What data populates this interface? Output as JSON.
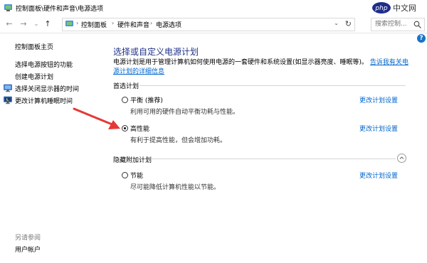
{
  "window": {
    "title": "控制面板\\硬件和声音\\电源选项",
    "watermark": "php中文网"
  },
  "nav": {
    "breadcrumb": [
      "控制面板",
      "硬件和声音",
      "电源选项"
    ],
    "search_placeholder": "搜索控制..."
  },
  "sidebar": {
    "home": "控制面板主页",
    "items": [
      {
        "label": "选择电源按钮的功能",
        "icon": ""
      },
      {
        "label": "创建电源计划",
        "icon": ""
      },
      {
        "label": "选择关闭显示器的时间",
        "icon": "monitor-icon"
      },
      {
        "label": "更改计算机睡眠时间",
        "icon": "moon-icon"
      }
    ],
    "see_also": "另请参阅",
    "user_accounts": "用户帐户"
  },
  "main": {
    "title": "选择或自定义电源计划",
    "description": "电源计划是用于管理计算机如何使用电源的一套硬件和系统设置(如显示器亮度、睡眠等)。",
    "description_link": "告诉我有关电源计划的详细信息",
    "preferred_label": "首选计划",
    "hidden_label": "隐藏附加计划",
    "plans": [
      {
        "name": "平衡 (推荐)",
        "desc": "利用可用的硬件自动平衡功耗与性能。",
        "link": "更改计划设置",
        "selected": false
      },
      {
        "name": "高性能",
        "desc": "有利于提高性能，但会增加功耗。",
        "link": "更改计划设置",
        "selected": true
      },
      {
        "name": "节能",
        "desc": "尽可能降低计算机性能以节能。",
        "link": "更改计划设置",
        "selected": false
      }
    ]
  },
  "colors": {
    "title": "#1e3287",
    "link": "#0066cc",
    "arrow": "#e53935"
  }
}
